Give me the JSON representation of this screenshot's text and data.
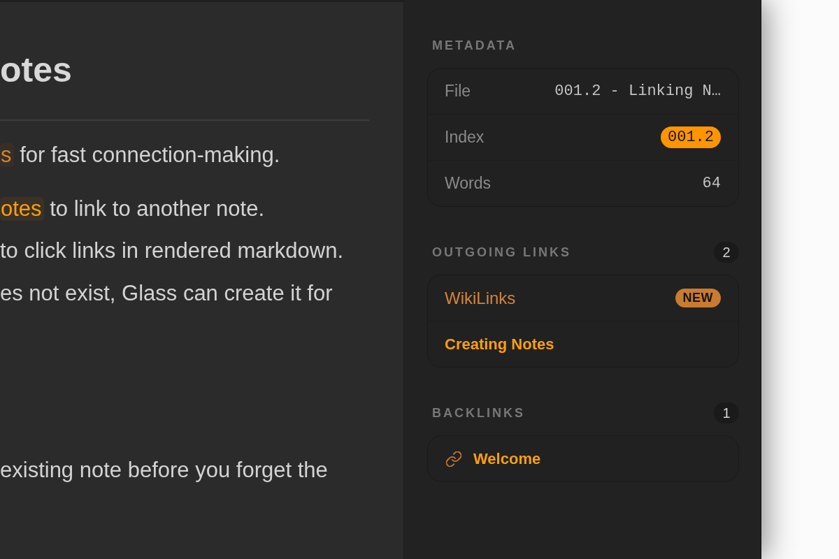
{
  "editor": {
    "title": "otes",
    "paragraphs": [
      {
        "link": {
          "text": "s",
          "new": true
        },
        "text": "for fast connection-making."
      },
      {
        "link": {
          "text": "otes",
          "new": false
        },
        "text": "to link to another note."
      },
      {
        "text": "to click links in rendered markdown."
      },
      {
        "text": "es not exist, Glass can create it for"
      },
      {
        "text": "existing note before you forget the"
      }
    ]
  },
  "sidebar": {
    "metadata": {
      "heading": "METADATA",
      "rows": [
        {
          "label": "File",
          "value": "001.2 - Linking N…",
          "kind": "text"
        },
        {
          "label": "Index",
          "value": "001.2",
          "kind": "badge"
        },
        {
          "label": "Words",
          "value": "64",
          "kind": "text"
        }
      ]
    },
    "outgoing_links": {
      "heading": "OUTGOING LINKS",
      "count": "2",
      "items": [
        {
          "label": "WikiLinks",
          "new": true,
          "badge": "NEW"
        },
        {
          "label": "Creating Notes",
          "new": false
        }
      ]
    },
    "backlinks": {
      "heading": "BACKLINKS",
      "count": "1",
      "items": [
        {
          "label": "Welcome"
        }
      ]
    }
  }
}
